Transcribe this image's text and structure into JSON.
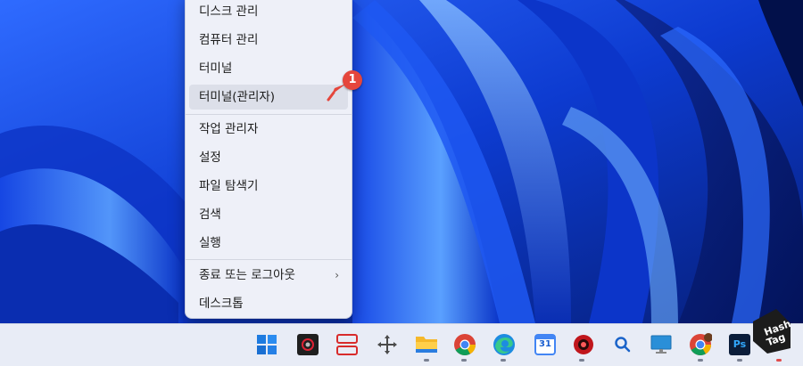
{
  "context_menu": {
    "items": [
      {
        "label": "디스크 관리"
      },
      {
        "label": "컴퓨터 관리"
      },
      {
        "label": "터미널"
      },
      {
        "label": "터미널(관리자)"
      },
      {
        "label": "작업 관리자"
      },
      {
        "label": "설정"
      },
      {
        "label": "파일 탐색기"
      },
      {
        "label": "검색"
      },
      {
        "label": "실행"
      },
      {
        "label": "종료 또는 로그아웃"
      },
      {
        "label": "데스크톱"
      }
    ],
    "highlighted_item": "터미널(관리자)",
    "submenu_chevron": "›"
  },
  "annotation": {
    "badge_number": "1"
  },
  "taskbar": {
    "icons": [
      "windows-start-icon",
      "camera-app-icon",
      "snap-layout-icon",
      "move-arrows-icon",
      "file-explorer-icon",
      "chrome-icon",
      "edge-icon",
      "calendar-icon",
      "red-app-icon",
      "search-icon",
      "monitor-icon",
      "chrome-profile-icon",
      "photoshop-icon"
    ],
    "calendar_day": "31",
    "photoshop_label": "Ps"
  },
  "watermark": {
    "line1": "Hash",
    "line2": "Tag"
  },
  "colors": {
    "menu_bg": "#eef0f8",
    "highlight": "#dcdfe9",
    "badge": "#e5463c",
    "wallpaper_deep": "#0a2ea0",
    "wallpaper_light": "#4c8cff"
  }
}
